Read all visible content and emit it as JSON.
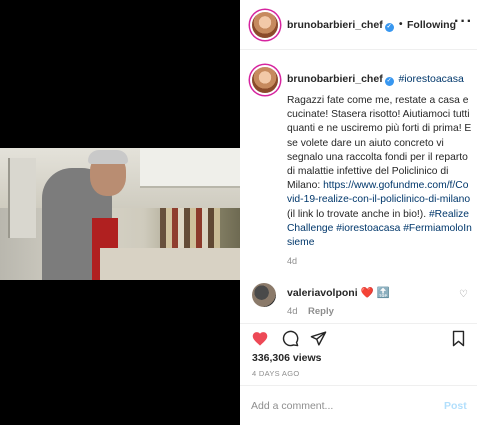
{
  "header": {
    "username": "brunobarbieri_chef",
    "separator": "•",
    "follow_label": "Following",
    "more_icon": "more-horizontal-icon"
  },
  "caption": {
    "username": "brunobarbieri_chef",
    "hashtag": "#iorestoacasa",
    "text": "Ragazzi fate come me, restate a casa e cucinate! Stasera risotto! Aiutiamoci tutti quanti e ne usciremo più forti di prima! E se volete dare un aiuto concreto vi segnalo una raccolta fondi per il reparto di malattie infettive del Policlinico di Milano:",
    "link": "https://www.gofundme.com/f/Covid-19-realize-con-il-policlinico-di-milano",
    "after_link": " (il link lo trovate anche in bio!).",
    "tags": "#RealizeChallenge #iorestoacasa #FermiamoloInsieme",
    "time": "4d"
  },
  "comment": {
    "username": "valeriavolponi",
    "text": "❤️ 🔝",
    "time": "4d",
    "reply_label": "Reply"
  },
  "actions": {
    "likes": "336,306 views",
    "date": "4 DAYS AGO"
  },
  "comment_box": {
    "placeholder": "Add a comment...",
    "post_label": "Post"
  },
  "colors": {
    "like_red": "#ed4956",
    "link_blue": "#00376b",
    "verified_blue": "#3897f0",
    "post_disabled": "#b2dffc"
  }
}
